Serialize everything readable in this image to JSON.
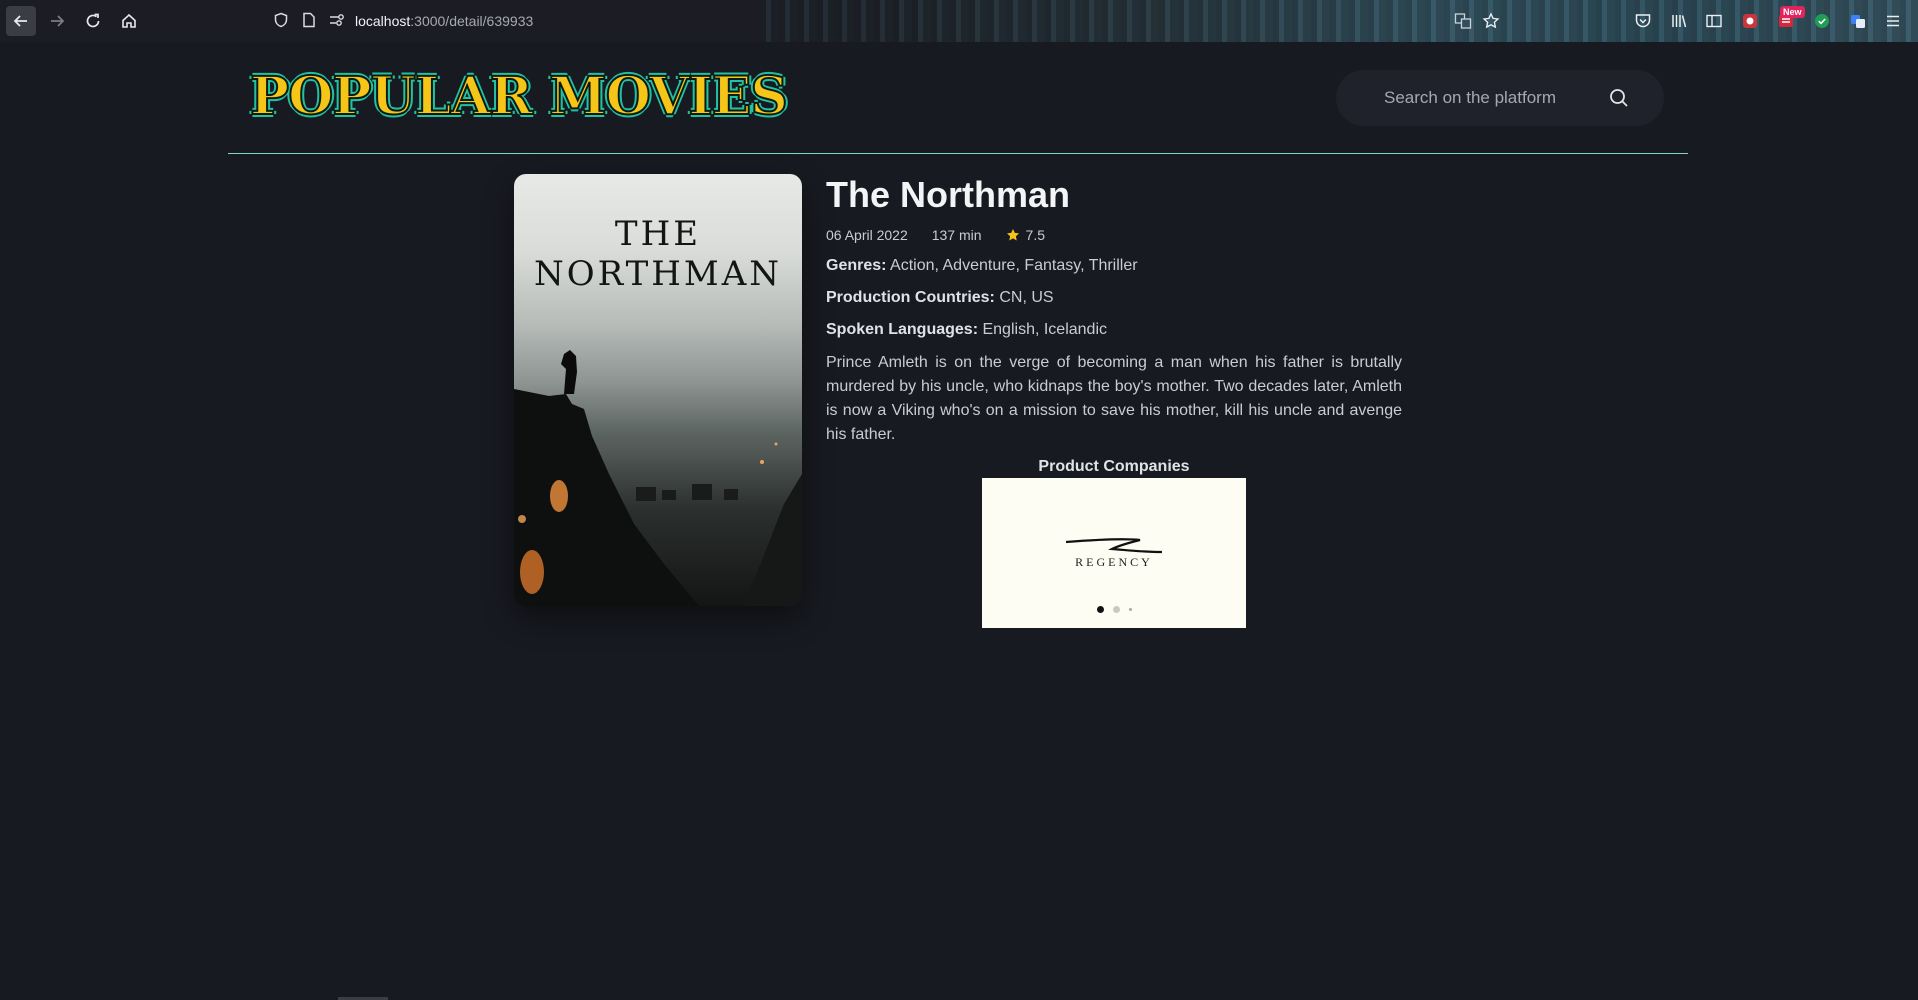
{
  "browser": {
    "url_host": "localhost",
    "url_path": ":3000/detail/639933",
    "new_badge": "New"
  },
  "header": {
    "logo_text": "POPULAR MOVIES",
    "search_placeholder": "Search on the platform"
  },
  "movie": {
    "poster_title": "THE NORTHMAN",
    "title": "The Northman",
    "release_date": "06 April 2022",
    "runtime": "137 min",
    "rating": "7.5",
    "genres_label": "Genres:",
    "genres": "Action, Adventure, Fantasy, Thriller",
    "countries_label": "Production Countries:",
    "countries": "CN, US",
    "languages_label": "Spoken Languages:",
    "languages": "English, Icelandic",
    "overview": "Prince Amleth is on the verge of becoming a man when his father is brutally murdered by his uncle, who kidnaps the boy's mother. Two decades later, Amleth is now a Viking who's on a mission to save his mother, kill his uncle and avenge his father."
  },
  "companies": {
    "title": "Product Companies",
    "current": "REGENCY",
    "slides_active_index": 0
  },
  "colors": {
    "background": "#181a21",
    "accent_line": "#7fd6c9",
    "logo_fill": "#f5c518",
    "star": "#f5c518"
  }
}
